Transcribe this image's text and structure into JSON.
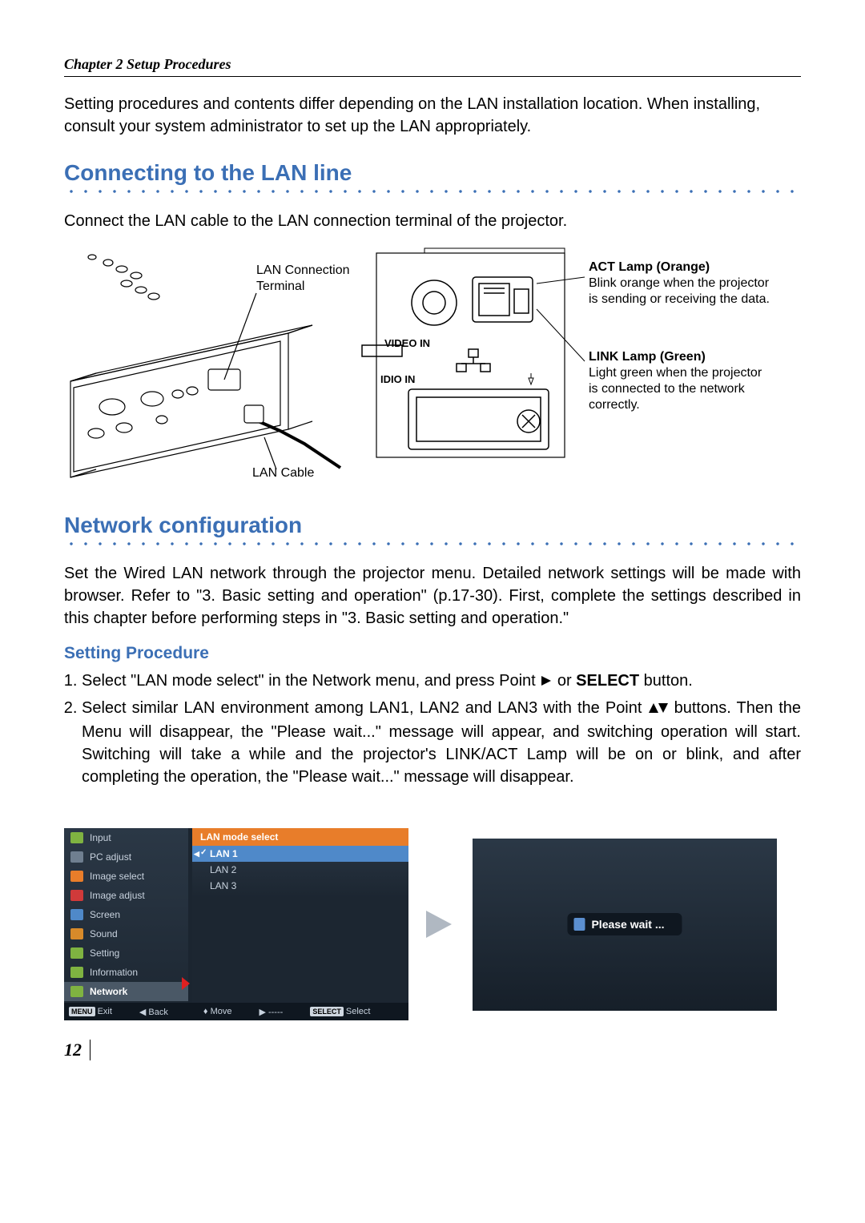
{
  "chapter_header": "Chapter 2 Setup Procedures",
  "intro_paragraph": "Setting procedures and contents differ depending on the LAN installation location. When installing, consult your system administrator to set up the LAN appropriately.",
  "section1": {
    "title": "Connecting to the LAN line",
    "body": "Connect the LAN cable to the LAN connection terminal of the projector."
  },
  "diagram": {
    "lan_connection_label": "LAN Connection Terminal",
    "lan_cable_label": "LAN Cable",
    "video_in_label": "VIDEO IN",
    "audio_in_label": "IDIO IN",
    "act_lamp": {
      "title": "ACT Lamp (Orange)",
      "desc": "Blink orange when the projector is sending or receiving the data."
    },
    "link_lamp": {
      "title": "LINK Lamp (Green)",
      "desc": "Light green when the projector is connected to the network correctly."
    }
  },
  "section2": {
    "title": "Network configuration",
    "body": "Set the Wired LAN network through the projector menu. Detailed network settings will be made with browser. Refer to \"3. Basic setting and operation\" (p.17-30). First, complete the settings described in this chapter before performing steps in \"3. Basic setting and operation.\""
  },
  "setting_procedure": {
    "heading": "Setting Procedure",
    "step1_a": "Select \"LAN mode select\" in the Network menu, and press Point ",
    "step1_b": " or ",
    "step1_select_word": "SELECT",
    "step1_c": " button.",
    "step2_a": "Select similar LAN environment among LAN1, LAN2 and LAN3 with the Point ",
    "step2_b": " buttons. Then the Menu will disappear, the \"Please wait...\" message will appear, and switching operation will start. Switching will take a while and the projector's LINK/ACT Lamp will be on or blink, and after completing the operation, the \"Please wait...\" message will disappear."
  },
  "menu": {
    "items": [
      "Input",
      "PC adjust",
      "Image select",
      "Image adjust",
      "Screen",
      "Sound",
      "Setting",
      "Information",
      "Network"
    ],
    "active_index": 8,
    "right_header": "LAN mode select",
    "lan_options": [
      "LAN 1",
      "LAN 2",
      "LAN 3"
    ],
    "lan_selected_index": 0,
    "footer": {
      "exit_key": "MENU",
      "exit_label": "Exit",
      "back_label": "Back",
      "move_label": "Move",
      "dashes": "-----",
      "select_key": "SELECT",
      "select_label": "Select"
    }
  },
  "wait_message": "Please wait ...",
  "page_number": "12",
  "icon_colors": [
    "#7fb341",
    "#6f7f90",
    "#e87d2a",
    "#d03a3a",
    "#4f89c9",
    "#d78a2a",
    "#7fb341",
    "#7fb341",
    "#7fb341"
  ]
}
